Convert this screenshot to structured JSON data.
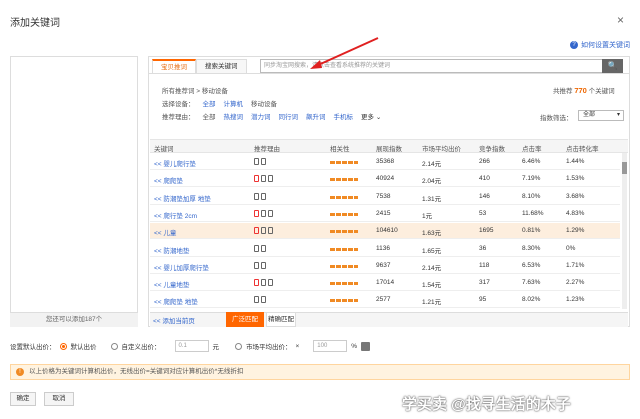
{
  "dialog": {
    "title": "添加关键词",
    "close": "×",
    "help": "如何设置关键词"
  },
  "left_panel": {
    "footer": "您还可以添加187个"
  },
  "tabs": [
    {
      "label": "宝贝推词"
    },
    {
      "label": "搜索关键词"
    }
  ],
  "search": {
    "placeholder": "同步淘宝网搜索，请点击查看系统推荐的关键词",
    "button": "🔍"
  },
  "filters": {
    "words_label": "所有推荐词",
    "device_label": "移动设备",
    "total_prefix": "共推荐",
    "total_count": "770",
    "total_suffix": "个关键词",
    "device_row_label": "选择设备：",
    "devices": [
      "全部",
      "计算机",
      "移动设备"
    ],
    "reason_row_label": "推荐理由：",
    "reasons": [
      "全部",
      "热搜词",
      "潜力词",
      "同行词",
      "飙升词",
      "手机标"
    ],
    "more": "更多",
    "index_filter_label": "指数筛选：",
    "index_filter_value": "全部"
  },
  "table": {
    "headers": [
      "关键词",
      "推荐理由",
      "相关性",
      "展现指数",
      "市场平均出价",
      "竞争指数",
      "点击率",
      "点击转化率"
    ],
    "rows": [
      {
        "kw": "<< 婴儿爬行垫",
        "impr": "35368",
        "bid": "2.14元",
        "comp": "266",
        "ctr": "6.46%",
        "cvr": "1.44%",
        "hl": false,
        "hot": false
      },
      {
        "kw": "<< 爬爬垫",
        "impr": "40924",
        "bid": "2.04元",
        "comp": "410",
        "ctr": "7.19%",
        "cvr": "1.53%",
        "hl": false,
        "hot": true
      },
      {
        "kw": "<< 防潮垫加厚 地垫",
        "impr": "7538",
        "bid": "1.31元",
        "comp": "146",
        "ctr": "8.10%",
        "cvr": "3.68%",
        "hl": false,
        "hot": false
      },
      {
        "kw": "<< 爬行垫 2cm",
        "impr": "2415",
        "bid": "1元",
        "comp": "53",
        "ctr": "11.68%",
        "cvr": "4.83%",
        "hl": false,
        "hot": true
      },
      {
        "kw": "<< 儿童",
        "impr": "104610",
        "bid": "1.63元",
        "comp": "1695",
        "ctr": "0.81%",
        "cvr": "1.29%",
        "hl": true,
        "hot": true
      },
      {
        "kw": "<< 防潮地垫",
        "impr": "1136",
        "bid": "1.65元",
        "comp": "36",
        "ctr": "8.30%",
        "cvr": "0%",
        "hl": false,
        "hot": false
      },
      {
        "kw": "<< 婴儿加厚爬行垫",
        "impr": "9637",
        "bid": "2.14元",
        "comp": "118",
        "ctr": "6.53%",
        "cvr": "1.71%",
        "hl": false,
        "hot": false
      },
      {
        "kw": "<< 儿童地垫",
        "impr": "17014",
        "bid": "1.54元",
        "comp": "317",
        "ctr": "7.63%",
        "cvr": "2.27%",
        "hl": false,
        "hot": true
      },
      {
        "kw": "<< 爬爬垫 地垫",
        "impr": "2577",
        "bid": "1.21元",
        "comp": "95",
        "ctr": "8.02%",
        "cvr": "1.23%",
        "hl": false,
        "hot": false
      }
    ]
  },
  "bottom": {
    "add_all": "<<  添加当前页",
    "broad_match": "广泛匹配",
    "exact_match": "精确匹配"
  },
  "bid": {
    "label": "设置默认出价：",
    "opt1": "默认出价",
    "opt2": "自定义出价：",
    "custom_value": "0.1",
    "unit1": "元",
    "opt3": "市场平均出价：",
    "times": "×",
    "percent_value": "100",
    "unit2": "%"
  },
  "notice": {
    "icon": "!",
    "text": "以上价格为关键词计算机出价，无线出价=关键词对应计算机出价*无线折扣"
  },
  "actions": {
    "ok": "确定",
    "cancel": "取消"
  },
  "watermark": "学买卖 @找寻生活的木子"
}
